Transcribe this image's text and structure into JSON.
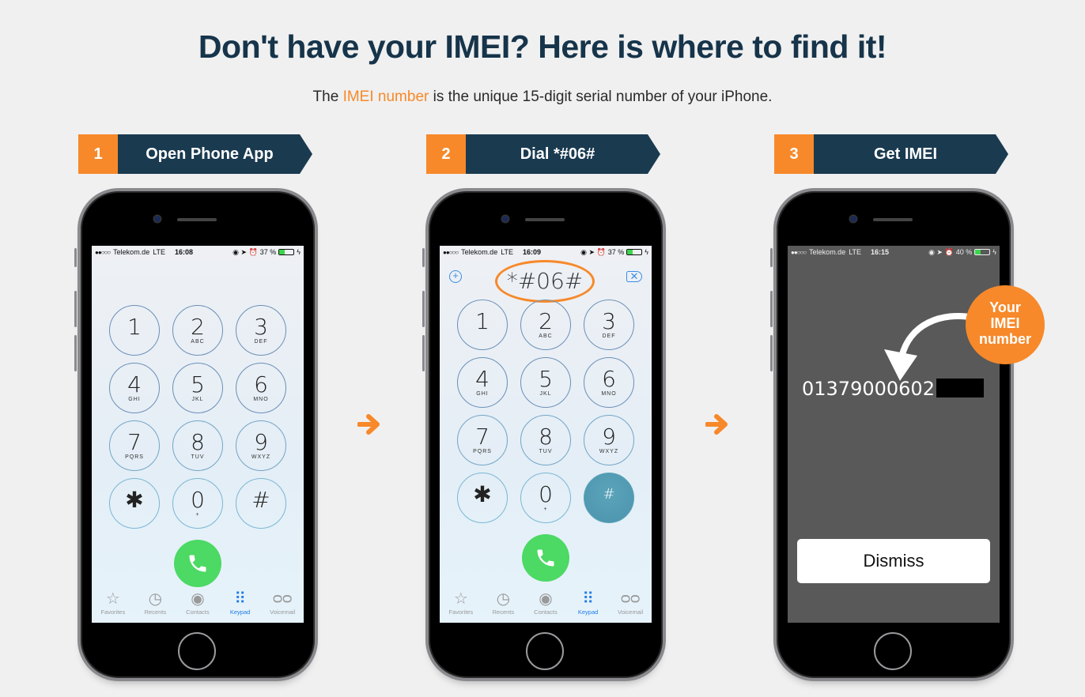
{
  "header": {
    "title": "Don't have your IMEI? Here is where to find it!",
    "subtitle_pre": "The ",
    "subtitle_highlight": "IMEI number",
    "subtitle_post": " is the unique 15-digit serial number of your iPhone."
  },
  "colors": {
    "accent": "#f7892a",
    "navy": "#1a3a50",
    "title": "#16344a",
    "call_green": "#4cd964",
    "tab_selected": "#1f7be6"
  },
  "steps": [
    {
      "number": "1",
      "label": "Open Phone App"
    },
    {
      "number": "2",
      "label": "Dial *#06#"
    },
    {
      "number": "3",
      "label": "Get IMEI"
    }
  ],
  "phones": [
    {
      "status": {
        "signal": "●●○○○",
        "carrier": "Telekom.de",
        "network": "LTE",
        "time": "16:08",
        "icons": "◉ ➤ ⏰",
        "battery": "37 %",
        "battery_level": 0.37
      }
    },
    {
      "status": {
        "signal": "●●○○○",
        "carrier": "Telekom.de",
        "network": "LTE",
        "time": "16:09",
        "icons": "◉ ➤ ⏰",
        "battery": "37 %",
        "battery_level": 0.37
      },
      "dialed": "*#06#",
      "add_icon": "+",
      "delete_icon": "✕"
    },
    {
      "status": {
        "signal": "●●○○○",
        "carrier": "Telekom.de",
        "network": "LTE",
        "time": "16:15",
        "icons": "◉ ➤ ⏰",
        "battery": "40 %",
        "battery_level": 0.4
      },
      "imei_visible": "01379000602",
      "dismiss_label": "Dismiss"
    }
  ],
  "keypad": [
    {
      "digit": "1",
      "letters": ""
    },
    {
      "digit": "2",
      "letters": "ABC"
    },
    {
      "digit": "3",
      "letters": "DEF"
    },
    {
      "digit": "4",
      "letters": "GHI"
    },
    {
      "digit": "5",
      "letters": "JKL"
    },
    {
      "digit": "6",
      "letters": "MNO"
    },
    {
      "digit": "7",
      "letters": "PQRS"
    },
    {
      "digit": "8",
      "letters": "TUV"
    },
    {
      "digit": "9",
      "letters": "WXYZ"
    },
    {
      "digit": "✱",
      "letters": ""
    },
    {
      "digit": "0",
      "letters": "+"
    },
    {
      "digit": "#",
      "letters": ""
    }
  ],
  "tabs": [
    {
      "label": "Favorites",
      "icon": "☆"
    },
    {
      "label": "Recents",
      "icon": "◷"
    },
    {
      "label": "Contacts",
      "icon": "◉"
    },
    {
      "label": "Keypad",
      "icon": "⠿"
    },
    {
      "label": "Voicemail",
      "icon": "ᴑᴑ"
    }
  ],
  "badge": {
    "line1": "Your",
    "line2": "IMEI",
    "line3": "number"
  }
}
